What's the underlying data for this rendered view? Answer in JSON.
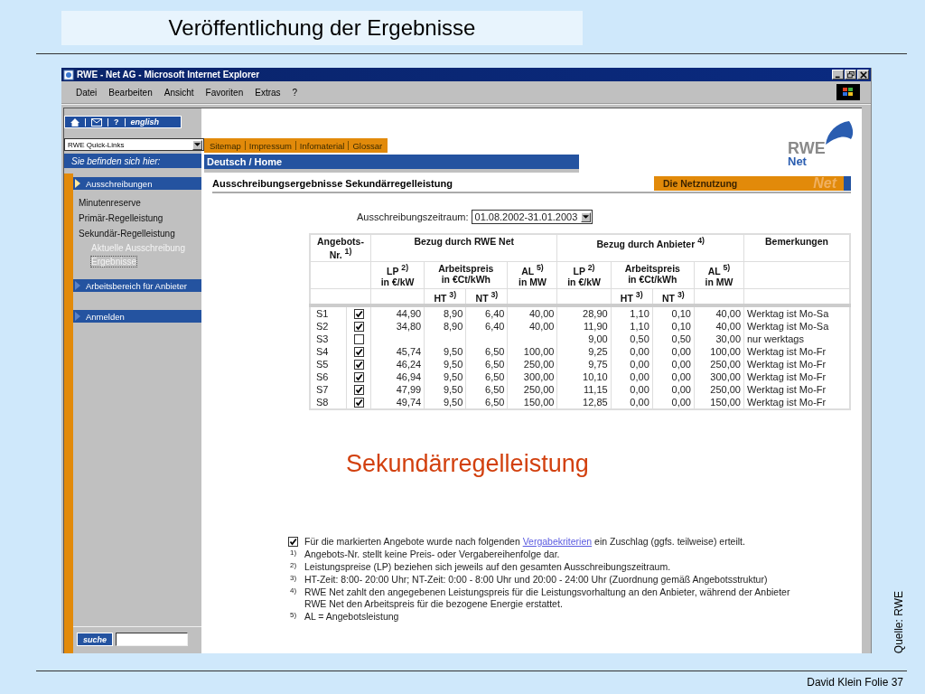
{
  "slide": {
    "title": "Veröffentlichung der Ergebnisse",
    "annotation": "Sekundärregelleistung",
    "source": "Quelle: RWE",
    "footer": "David Klein Folie 37"
  },
  "browser": {
    "title": "RWE - Net AG - Microsoft Internet Explorer",
    "menu": [
      "Datei",
      "Bearbeiten",
      "Ansicht",
      "Favoriten",
      "Extras",
      "?"
    ]
  },
  "site": {
    "nav_help": "?",
    "nav_language": "english",
    "quick_links": "RWE Quick-Links",
    "top_links": [
      "Sitemap",
      "Impressum",
      "Infomaterial",
      "Glossar"
    ],
    "location_label": "Sie befinden sich hier:",
    "location": "Deutsch / Home",
    "logo": [
      "RWE",
      "Net"
    ],
    "search_button": "suche",
    "sidebar": [
      {
        "label": "Ausschreibungen",
        "kind": "header",
        "selected": true
      },
      {
        "label": "Minutenreserve",
        "kind": "link",
        "selected": false
      },
      {
        "label": "Primär-Regelleistung",
        "kind": "link",
        "selected": false
      },
      {
        "label": "Sekundär-Regelleistung",
        "kind": "link",
        "selected": false,
        "children": [
          {
            "label": "Aktuelle Ausschreibung",
            "selected": false
          },
          {
            "label": "Ergebnisse",
            "selected": true
          }
        ]
      },
      {
        "label": "Arbeitsbereich für Anbieter",
        "kind": "header",
        "selected": false
      },
      {
        "label": "Anmelden",
        "kind": "header",
        "selected": false
      }
    ]
  },
  "page": {
    "heading": "Ausschreibungsergebnisse Sekundärregelleistung",
    "banner": "Die Netznutzung",
    "banner_mark": "Net",
    "period_label": "Ausschreibungszeitraum:",
    "period": "01.08.2002-31.01.2003",
    "table": {
      "number_heading": [
        "Angebots-",
        "Nr. $^{1)}$"
      ],
      "remarks_heading": "Bemerkungen",
      "groups": [
        {
          "label": "Bezug durch RWE Net",
          "lp": [
            "LP $^{2)}$",
            "in €/kW"
          ],
          "price": [
            "Arbeitspreis",
            "in €Ct/kWh"
          ],
          "ht": "HT $^{3)}$",
          "nt": "NT $^{3)}$",
          "al": [
            "AL $^{5)}$",
            "in MW"
          ]
        },
        {
          "label": "Bezug durch Anbieter $^{4)}$",
          "lp": [
            "LP $^{2)}$",
            "in €/kW"
          ],
          "price": [
            "Arbeitspreis",
            "in €Ct/kWh"
          ],
          "ht": "HT $^{3)}$",
          "nt": "NT $^{3)}$",
          "al": [
            "AL $^{5)}$",
            "in MW"
          ]
        }
      ],
      "rows": [
        {
          "no": "S1",
          "checked": true,
          "rwe": [
            "44,90",
            "8,90",
            "6,40",
            "40,00"
          ],
          "bidder": [
            "28,90",
            "1,10",
            "0,10",
            "40,00"
          ],
          "remark": "Werktag ist Mo-Sa"
        },
        {
          "no": "S2",
          "checked": true,
          "rwe": [
            "34,80",
            "8,90",
            "6,40",
            "40,00"
          ],
          "bidder": [
            "11,90",
            "1,10",
            "0,10",
            "40,00"
          ],
          "remark": "Werktag ist Mo-Sa"
        },
        {
          "no": "S3",
          "checked": false,
          "bidder": [
            "9,00",
            "0,50",
            "0,50",
            "30,00"
          ],
          "remark": "nur werktags"
        },
        {
          "no": "S4",
          "checked": true,
          "rwe": [
            "45,74",
            "9,50",
            "6,50",
            "100,00"
          ],
          "bidder": [
            "9,25",
            "0,00",
            "0,00",
            "100,00"
          ],
          "remark": "Werktag ist Mo-Fr"
        },
        {
          "no": "S5",
          "checked": true,
          "rwe": [
            "46,24",
            "9,50",
            "6,50",
            "250,00"
          ],
          "bidder": [
            "9,75",
            "0,00",
            "0,00",
            "250,00"
          ],
          "remark": "Werktag ist Mo-Fr"
        },
        {
          "no": "S6",
          "checked": true,
          "rwe": [
            "46,94",
            "9,50",
            "6,50",
            "300,00"
          ],
          "bidder": [
            "10,10",
            "0,00",
            "0,00",
            "300,00"
          ],
          "remark": "Werktag ist Mo-Fr"
        },
        {
          "no": "S7",
          "checked": true,
          "rwe": [
            "47,99",
            "9,50",
            "6,50",
            "250,00"
          ],
          "bidder": [
            "11,15",
            "0,00",
            "0,00",
            "250,00"
          ],
          "remark": "Werktag ist Mo-Fr"
        },
        {
          "no": "S8",
          "checked": true,
          "rwe": [
            "49,74",
            "9,50",
            "6,50",
            "150,00"
          ],
          "bidder": [
            "12,85",
            "0,00",
            "0,00",
            "150,00"
          ],
          "remark": "Werktag ist Mo-Fr"
        }
      ]
    },
    "notes": [
      {
        "kind": "checkbox",
        "checked": true,
        "text": "Für die markierten Angebote wurde nach folgenden",
        "link": "Vergabekriterien",
        "after": "ein Zuschlag (ggfs. teilweise) erteilt."
      },
      {
        "kind": "footnote",
        "marker": "1)",
        "text": "Angebots-Nr. stellt keine Preis- oder Vergabereihenfolge dar."
      },
      {
        "kind": "footnote",
        "marker": "2)",
        "text": "Leistungspreise (LP) beziehen sich jeweils auf den gesamten Ausschreibungszeitraum."
      },
      {
        "kind": "footnote",
        "marker": "3)",
        "text": "HT-Zeit: 8:00- 20:00 Uhr; NT-Zeit: 0:00 - 8:00 Uhr und 20:00 - 24:00 Uhr (Zuordnung gemäß Angebotsstruktur)"
      },
      {
        "kind": "footnote",
        "marker": "4)",
        "text": "RWE Net zahlt den angegebenen Leistungspreis für die Leistungsvorhaltung an den Anbieter, während der Anbieter RWE Net den Arbeitspreis für die bezogene Energie erstattet."
      },
      {
        "kind": "footnote",
        "marker": "5)",
        "text": "AL = Angebotsleistung"
      }
    ]
  }
}
